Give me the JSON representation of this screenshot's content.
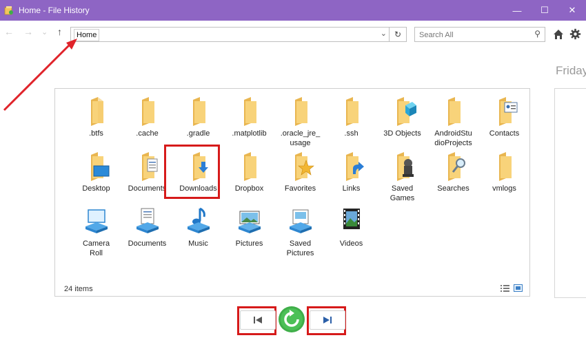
{
  "window": {
    "title": "Home - File History",
    "controls": [
      "—",
      "☐",
      "✕"
    ]
  },
  "toolbar": {
    "back": "←",
    "forward": "→",
    "recent": "⌄",
    "up": "↑",
    "address": "Home",
    "address_dropdown": "⌄",
    "refresh": "↻",
    "search_placeholder": "Search All",
    "search_icon": "⚲"
  },
  "timeline": {
    "day_label": "Friday"
  },
  "files": {
    "items": [
      {
        "label": ".btfs",
        "icon": "folder"
      },
      {
        "label": ".cache",
        "icon": "folder"
      },
      {
        "label": ".gradle",
        "icon": "folder"
      },
      {
        "label": ".matplotlib",
        "icon": "folder"
      },
      {
        "label": ".oracle_jre_\nusage",
        "icon": "folder"
      },
      {
        "label": ".ssh",
        "icon": "folder"
      },
      {
        "label": "3D Objects",
        "icon": "folder-3d-objects"
      },
      {
        "label": "AndroidStu\ndioProjects",
        "icon": "folder"
      },
      {
        "label": "Contacts",
        "icon": "folder-contacts"
      },
      {
        "label": "Desktop",
        "icon": "folder-desktop"
      },
      {
        "label": "Documents",
        "icon": "folder-documents"
      },
      {
        "label": "Downloads",
        "icon": "folder-downloads"
      },
      {
        "label": "Dropbox",
        "icon": "folder"
      },
      {
        "label": "Favorites",
        "icon": "folder-favorites"
      },
      {
        "label": "Links",
        "icon": "folder-links"
      },
      {
        "label": "Saved\nGames",
        "icon": "folder-saved-games"
      },
      {
        "label": "Searches",
        "icon": "folder-searches"
      },
      {
        "label": "vmlogs",
        "icon": "folder"
      },
      {
        "label": "Camera\nRoll",
        "icon": "library-camera-roll"
      },
      {
        "label": "Documents",
        "icon": "library-documents"
      },
      {
        "label": "Music",
        "icon": "library-music"
      },
      {
        "label": "Pictures",
        "icon": "library-pictures"
      },
      {
        "label": "Saved\nPictures",
        "icon": "library-saved-pictures"
      },
      {
        "label": "Videos",
        "icon": "library-videos"
      }
    ],
    "count_text": "24 items"
  },
  "controls": {
    "previous_icon": "previous-version-icon",
    "restore_icon": "restore-icon",
    "next_icon": "next-version-icon"
  },
  "colors": {
    "titlebar": "#8e65c4",
    "highlight": "#d61a1a",
    "folder": "#f5c96a",
    "restore_button": "#3fae49"
  }
}
